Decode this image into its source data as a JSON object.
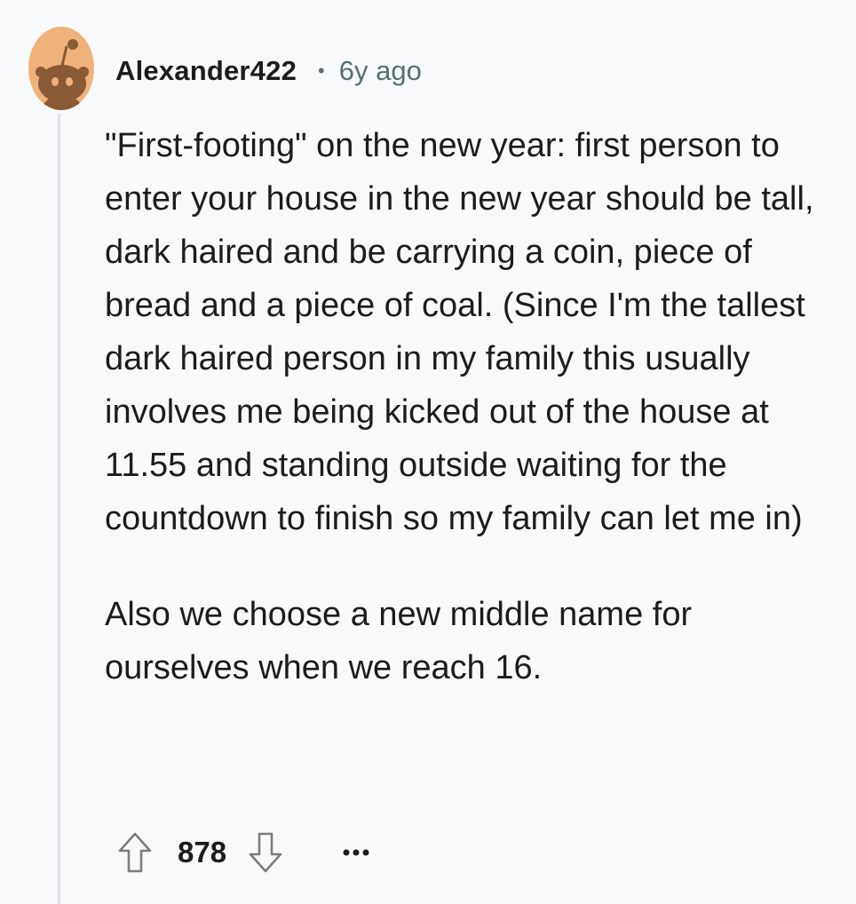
{
  "comment": {
    "author": "Alexander422",
    "separator": "•",
    "age": "6y ago",
    "paragraphs": [
      "\"First-footing\" on the new year: first person to enter your house in the new year should be tall, dark haired and be carrying a coin, piece of bread and a piece of coal. (Since I'm the tallest dark haired person in my family this usually involves me being kicked out of the house at 11.55 and standing outside waiting for the countdown to finish so my family can let me in)",
      "Also we choose a new middle name for ourselves when we reach 16."
    ],
    "score": "878"
  },
  "icons": {
    "avatar": "snoo-avatar-icon",
    "upvote": "arrow-up-outline-icon",
    "downvote": "arrow-down-outline-icon",
    "more": "ellipsis-icon"
  },
  "colors": {
    "background": "#f8f9fa",
    "avatar_bg": "#f0b27a",
    "avatar_snoo": "#8a5a34",
    "text": "#1c1c1c",
    "meta": "#576f76",
    "thread_line": "#dfe3e8"
  }
}
